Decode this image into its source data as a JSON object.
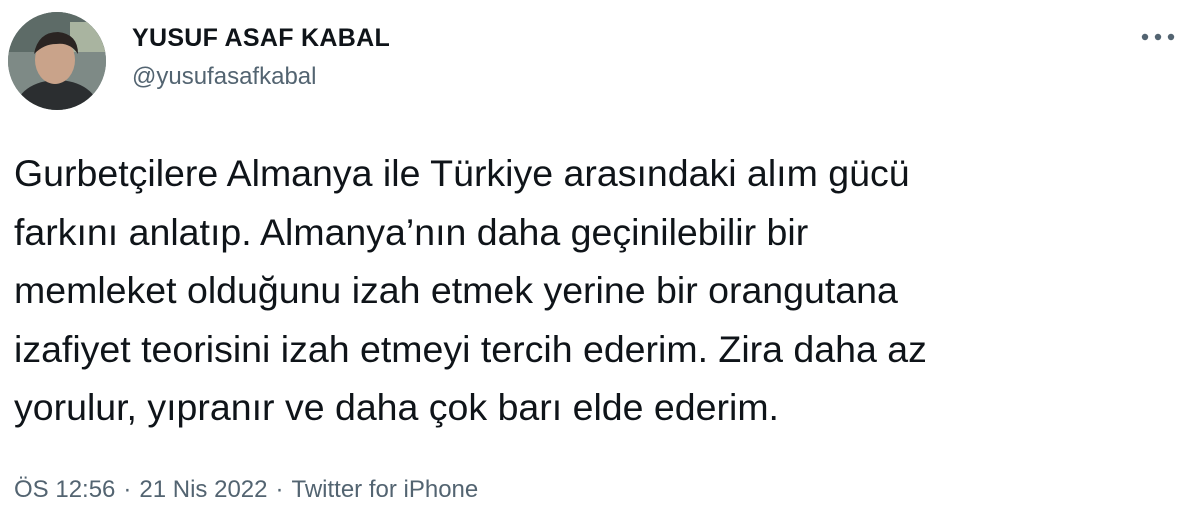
{
  "author": {
    "display_name": "YUSUF ASAF KABAL",
    "handle": "@yusufasafkabal",
    "avatar": "profile-photo"
  },
  "menu": {
    "icon": "more-horizontal-icon"
  },
  "tweet": {
    "text": "Gurbetçilere Almanya ile Türkiye arasındaki alım gücü\nfarkını anlatıp. Almanya’nın daha geçinilebilir bir\nmemleket olduğunu izah etmek yerine bir orangutana\nizafiyet teorisini izah etmeyi tercih ederim. Zira daha az\nyorulur, yıpranır ve daha çok barı elde ederim."
  },
  "meta": {
    "time": "ÖS 12:56",
    "date": "21 Nis 2022",
    "source": "Twitter for iPhone",
    "separator": "·"
  },
  "colors": {
    "text_primary": "#0f1419",
    "text_secondary": "#536471",
    "background": "#ffffff"
  }
}
